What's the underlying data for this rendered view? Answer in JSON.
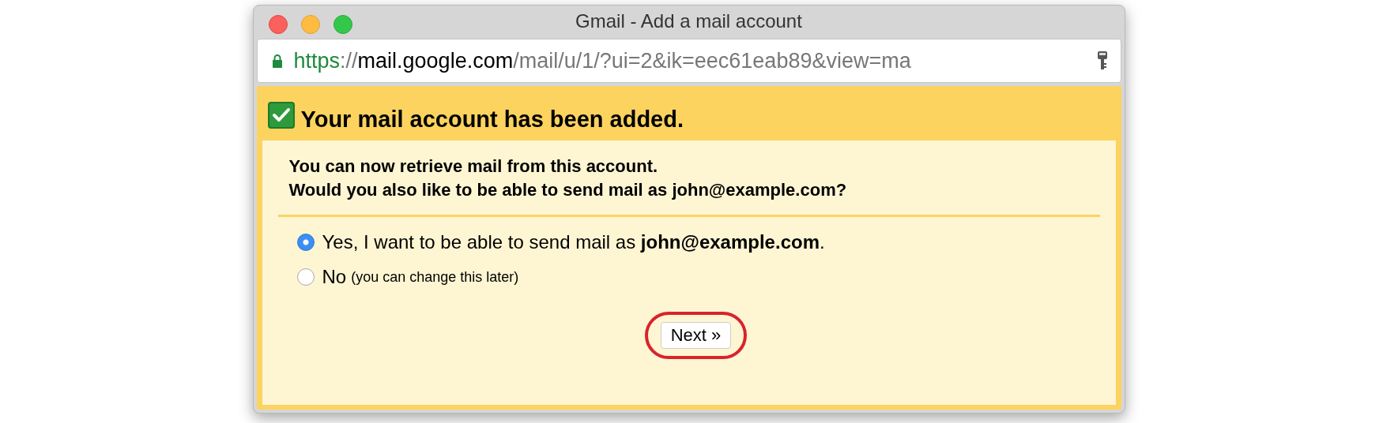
{
  "window": {
    "title": "Gmail - Add a mail account"
  },
  "address_bar": {
    "secure": true,
    "scheme": "https",
    "separator": "://",
    "host": "mail.google.com",
    "path": "/mail/u/1/?ui=2&ik=eec61eab89&view=ma"
  },
  "banner": {
    "checked": true,
    "title": "Your mail account has been added."
  },
  "message": [
    "You can now retrieve mail from this account.",
    "Would you also like to be able to send mail as john@example.com?"
  ],
  "options": [
    {
      "label": "Yes, I want to be able to send mail as **john@example.com**.",
      "selected": true
    },
    {
      "label": "No",
      "note": "(you can change this later)",
      "selected": false
    }
  ],
  "next_button": {
    "label": "Next »",
    "highlighted": true
  }
}
